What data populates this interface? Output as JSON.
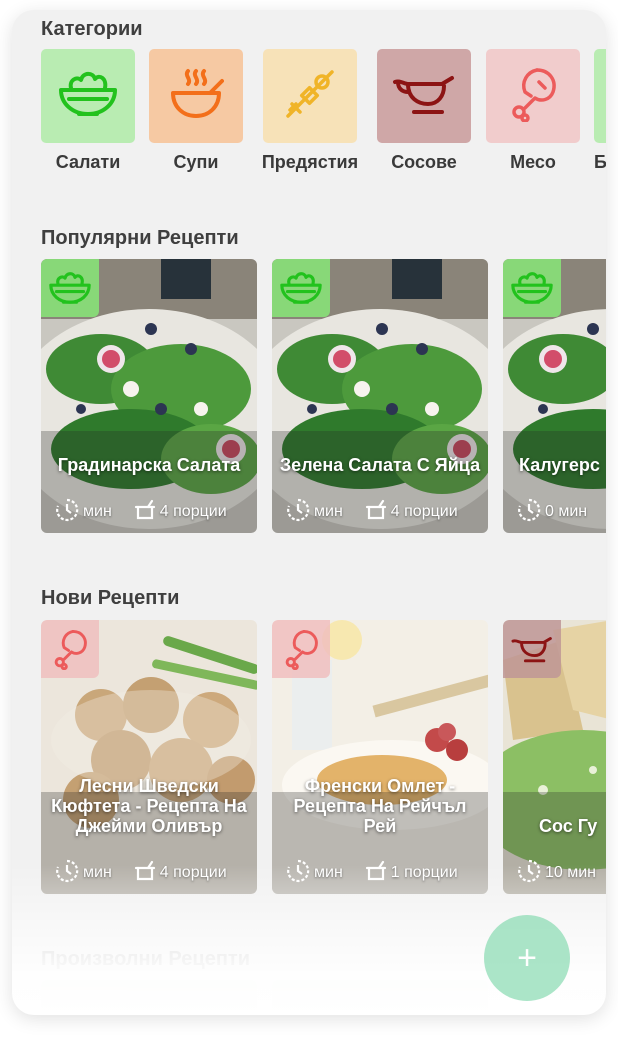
{
  "sections": {
    "categories": "Категории",
    "popular": "Популярни Рецепти",
    "new": "Нови Рецепти",
    "random": "Произволни Рецепти"
  },
  "categories": [
    {
      "label": "Салати",
      "icon": "salad-bowl-icon",
      "bg": "#b9ecb2",
      "color": "#22c21d"
    },
    {
      "label": "Супи",
      "icon": "soup-bowl-icon",
      "bg": "#f6c9a3",
      "color": "#f36f1a"
    },
    {
      "label": "Предястия",
      "icon": "skewer-icon",
      "bg": "#f7e2b8",
      "color": "#f0b428"
    },
    {
      "label": "Сосове",
      "icon": "gravy-boat-icon",
      "bg": "#cfa7a7",
      "color": "#8c1414"
    },
    {
      "label": "Месо",
      "icon": "meat-leg-icon",
      "bg": "#f1cccc",
      "color": "#ec5b5b"
    },
    {
      "label": "Б",
      "icon": "partial-category-icon",
      "bg": "#b9ecb2",
      "color": "#22c21d"
    }
  ],
  "popular": [
    {
      "name": "Градинарска Салата",
      "time": "мин",
      "servings": "4 порции"
    },
    {
      "name": "Зелена Салата С Яйца",
      "time": "мин",
      "servings": "4 порции"
    },
    {
      "name": "Калугерс",
      "time": "0 мин",
      "servings": ""
    }
  ],
  "new": [
    {
      "name": "Лесни Шведски Кюфтета - Рецепта На Джейми Оливър",
      "time": "мин",
      "servings": "4 порции"
    },
    {
      "name": "Френски Омлет - Рецепта На Рейчъл Рей",
      "time": "мин",
      "servings": "1 порции"
    },
    {
      "name": "Сос Гу",
      "time": "10 мин",
      "servings": ""
    }
  ],
  "fab": {
    "label": "+"
  }
}
